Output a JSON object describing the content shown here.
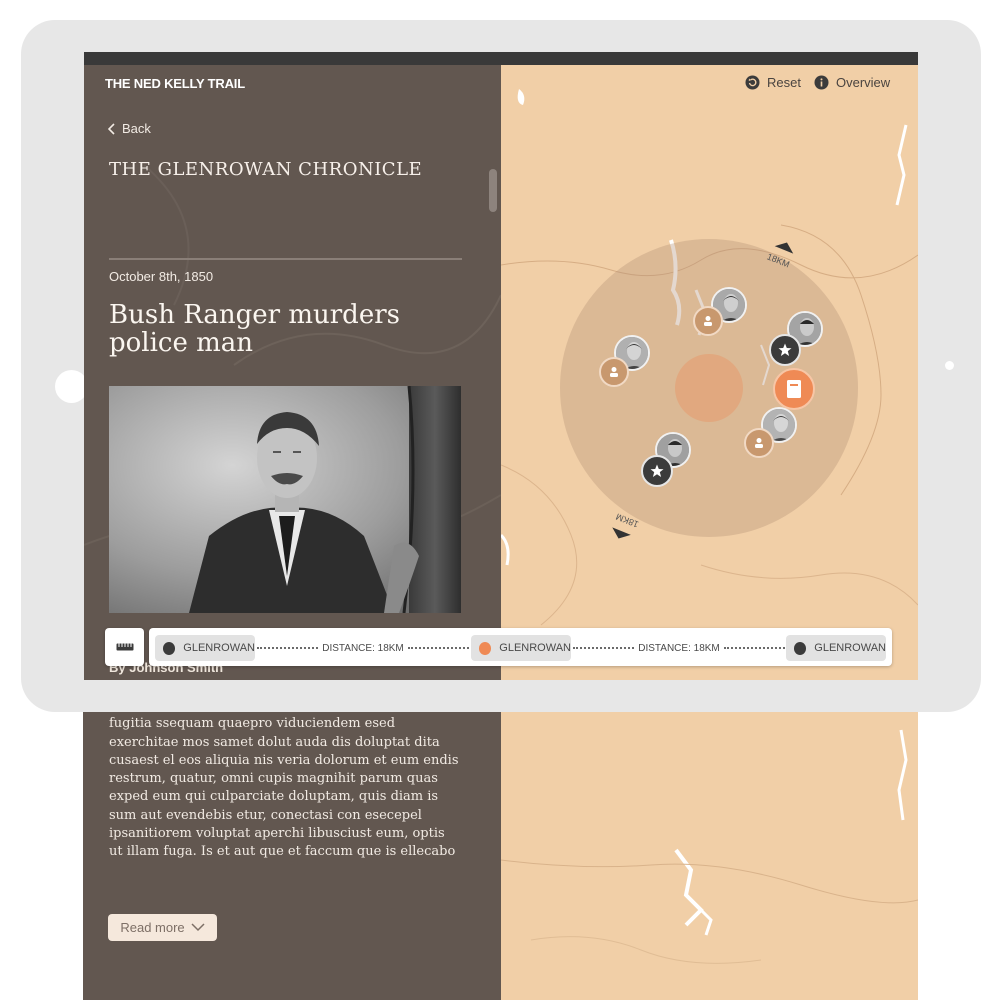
{
  "app": {
    "title": "THE NED KELLY TRAIL"
  },
  "nav": {
    "back_label": "Back"
  },
  "map_controls": {
    "reset_label": "Reset",
    "overview_label": "Overview",
    "zoom_in_label": "+",
    "zoom_out_label": "−"
  },
  "article": {
    "publication": "THE GLENROWAN CHRONICLE",
    "date": "October 8th, 1850",
    "headline": "Bush Ranger murders police man",
    "byline": "By Johnson Smith",
    "body": "Sed molorumquatur, Aceratum quis ulmil quam quat fugitia ssequam quaepro viduciendem esed exerchitae mos samet dolut auda dis doluptat dita cusaest el eos aliquia nis veria dolorum et eum endis restrum, quatur, omni cupis magnihit parum quas exped eum qui culparciate doluptam, quis diam is sum aut evendebis etur, conectasi con esecepel ipsanitiorem voluptat aperchi libusciust eum, optis ut illam fuga. Is et aut que et faccum que is ellecabo",
    "read_more_label": "Read more"
  },
  "map": {
    "distance_labels": [
      "18KM",
      "18KM"
    ]
  },
  "route": {
    "stops": [
      {
        "name": "GLENROWAN",
        "color": "#3b3b3b"
      },
      {
        "name": "GLENROWAN",
        "color": "#ef8a55"
      },
      {
        "name": "GLENROWAN",
        "color": "#3b3b3b"
      }
    ],
    "legs": [
      {
        "label": "DISTANCE: 18KM"
      },
      {
        "label": "DISTANCE: 18KM"
      }
    ]
  },
  "colors": {
    "panel_brown": "#625750",
    "map_tan": "#f1cfa7",
    "accent_orange": "#ef8a55",
    "marker_tan": "#c8986e",
    "marker_dark": "#3b3b3b"
  },
  "icons": [
    "chevron-left-icon",
    "reset-icon",
    "info-icon",
    "ruler-icon",
    "book-icon",
    "person-icon",
    "star-icon",
    "chevron-down-icon"
  ]
}
